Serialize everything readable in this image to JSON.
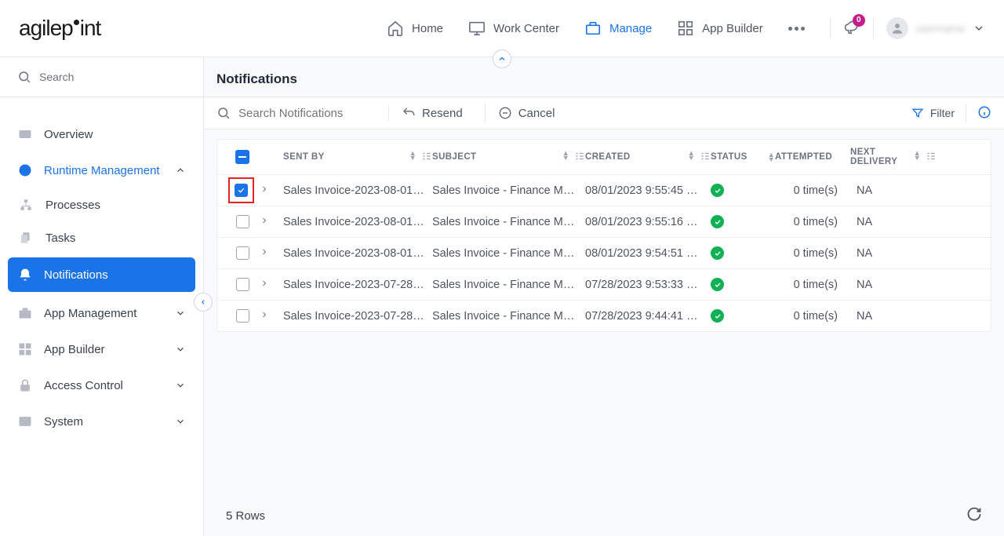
{
  "header": {
    "logo_text": "agilepoint",
    "nav": [
      {
        "label": "Home",
        "icon": "home"
      },
      {
        "label": "Work Center",
        "icon": "monitor"
      },
      {
        "label": "Manage",
        "icon": "briefcase",
        "active": true
      },
      {
        "label": "App Builder",
        "icon": "grid"
      }
    ],
    "badge_count": "0",
    "username": "username"
  },
  "sidebar": {
    "search_placeholder": "Search",
    "items": [
      {
        "label": "Overview",
        "icon": "chart"
      },
      {
        "label": "Runtime Management",
        "icon": "clock",
        "expanded": true,
        "selected": true
      },
      {
        "label": "App Management",
        "icon": "briefcase"
      },
      {
        "label": "App Builder",
        "icon": "grid"
      },
      {
        "label": "Access Control",
        "icon": "lock"
      },
      {
        "label": "System",
        "icon": "server"
      }
    ],
    "sub_items": [
      {
        "label": "Processes",
        "icon": "tree"
      },
      {
        "label": "Tasks",
        "icon": "copy"
      },
      {
        "label": "Notifications",
        "icon": "bell",
        "active": true
      }
    ]
  },
  "main": {
    "title": "Notifications",
    "search_placeholder": "Search Notifications",
    "resend_label": "Resend",
    "cancel_label": "Cancel",
    "filter_label": "Filter",
    "columns": {
      "sent_by": "SENT BY",
      "subject": "SUBJECT",
      "created": "CREATED",
      "status": "STATUS",
      "attempted": "ATTEMPTED",
      "next_delivery": "NEXT DELIVERY"
    },
    "rows": [
      {
        "checked": true,
        "highlighted": true,
        "sent_by": "Sales Invoice-2023-08-01…",
        "subject": "Sales Invoice - Finance M…",
        "created": "08/01/2023 9:55:45 …",
        "attempted": "0 time(s)",
        "next": "NA"
      },
      {
        "checked": false,
        "sent_by": "Sales Invoice-2023-08-01…",
        "subject": "Sales Invoice - Finance M…",
        "created": "08/01/2023 9:55:16 …",
        "attempted": "0 time(s)",
        "next": "NA"
      },
      {
        "checked": false,
        "sent_by": "Sales Invoice-2023-08-01…",
        "subject": "Sales Invoice - Finance M…",
        "created": "08/01/2023 9:54:51 …",
        "attempted": "0 time(s)",
        "next": "NA"
      },
      {
        "checked": false,
        "sent_by": "Sales Invoice-2023-07-28…",
        "subject": "Sales Invoice - Finance M…",
        "created": "07/28/2023 9:53:33 …",
        "attempted": "0 time(s)",
        "next": "NA"
      },
      {
        "checked": false,
        "sent_by": "Sales Invoice-2023-07-28…",
        "subject": "Sales Invoice - Finance M…",
        "created": "07/28/2023 9:44:41 …",
        "attempted": "0 time(s)",
        "next": "NA"
      }
    ],
    "footer_text": "5 Rows"
  }
}
